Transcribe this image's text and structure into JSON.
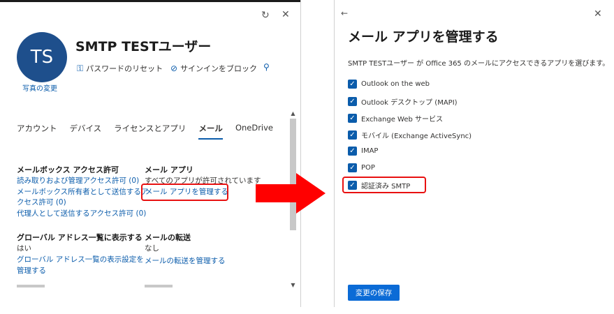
{
  "left": {
    "avatar_initials": "TS",
    "photo_change": "写真の変更",
    "user_name": "SMTP TESTユーザー",
    "actions": {
      "reset_password": "パスワードのリセット",
      "block_signin": "サインインをブロック"
    },
    "tabs": [
      "アカウント",
      "デバイス",
      "ライセンスとアプリ",
      "メール",
      "OneDrive"
    ],
    "mailbox_permissions": {
      "title": "メールボックス アクセス許可",
      "read_manage": "読み取りおよび管理アクセス許可 (0)",
      "send_as_line1": "メールボックス所有者として送信するア",
      "send_as_line2": "クセス許可 (0)",
      "send_on_behalf": "代理人として送信するアクセス許可 (0)"
    },
    "mail_apps": {
      "title": "メール アプリ",
      "status": "すべてのアプリが許可されています",
      "manage_link": "メール アプリを管理する"
    },
    "gal": {
      "title": "グローバル アドレス一覧に表示する",
      "value": "はい",
      "manage_line1": "グローバル アドレス一覧の表示設定を",
      "manage_line2": "管理する"
    },
    "forwarding": {
      "title": "メールの転送",
      "value": "なし",
      "manage_link": "メールの転送を管理する"
    }
  },
  "right": {
    "title": "メール アプリを管理する",
    "description": "SMTP TESTユーザー が Office 365 のメールにアクセスできるアプリを選びます。",
    "apps": [
      {
        "label": "Outlook on the web",
        "checked": true
      },
      {
        "label": "Outlook デスクトップ (MAPI)",
        "checked": true
      },
      {
        "label": "Exchange Web サービス",
        "checked": true
      },
      {
        "label": "モバイル (Exchange ActiveSync)",
        "checked": true
      },
      {
        "label": "IMAP",
        "checked": true
      },
      {
        "label": "POP",
        "checked": true
      },
      {
        "label": "認証済み SMTP",
        "checked": true
      }
    ],
    "save_label": "変更の保存"
  },
  "colors": {
    "accent": "#0b5cab",
    "highlight": "#e81010",
    "avatar": "#1e4f8c"
  }
}
